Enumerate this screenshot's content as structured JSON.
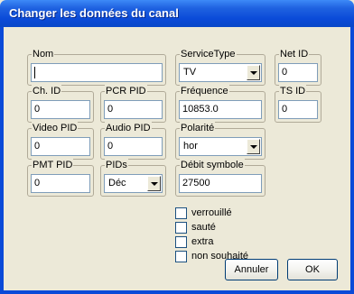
{
  "window": {
    "title": "Changer les données du canal"
  },
  "fields": {
    "nom": {
      "label": "Nom",
      "value": ""
    },
    "service_type": {
      "label": "ServiceType",
      "value": "TV"
    },
    "net_id": {
      "label": "Net ID",
      "value": "0"
    },
    "ch_id": {
      "label": "Ch. ID",
      "value": "0"
    },
    "pcr_pid": {
      "label": "PCR PID",
      "value": "0"
    },
    "frequence": {
      "label": "Fréquence",
      "value": "10853.0"
    },
    "ts_id": {
      "label": "TS ID",
      "value": "0"
    },
    "video_pid": {
      "label": "Video PID",
      "value": "0"
    },
    "audio_pid": {
      "label": "Audio PID",
      "value": "0"
    },
    "polarite": {
      "label": "Polarité",
      "value": "hor"
    },
    "pmt_pid": {
      "label": "PMT PID",
      "value": "0"
    },
    "pids": {
      "label": "PIDs",
      "value": "Déc"
    },
    "debit_symbole": {
      "label": "Débit symbole",
      "value": "27500"
    }
  },
  "checkboxes": [
    {
      "label": "verrouillé",
      "checked": false
    },
    {
      "label": "sauté",
      "checked": false
    },
    {
      "label": "extra",
      "checked": false
    },
    {
      "label": "non souhaité",
      "checked": false
    }
  ],
  "buttons": {
    "cancel": "Annuler",
    "ok": "OK"
  }
}
